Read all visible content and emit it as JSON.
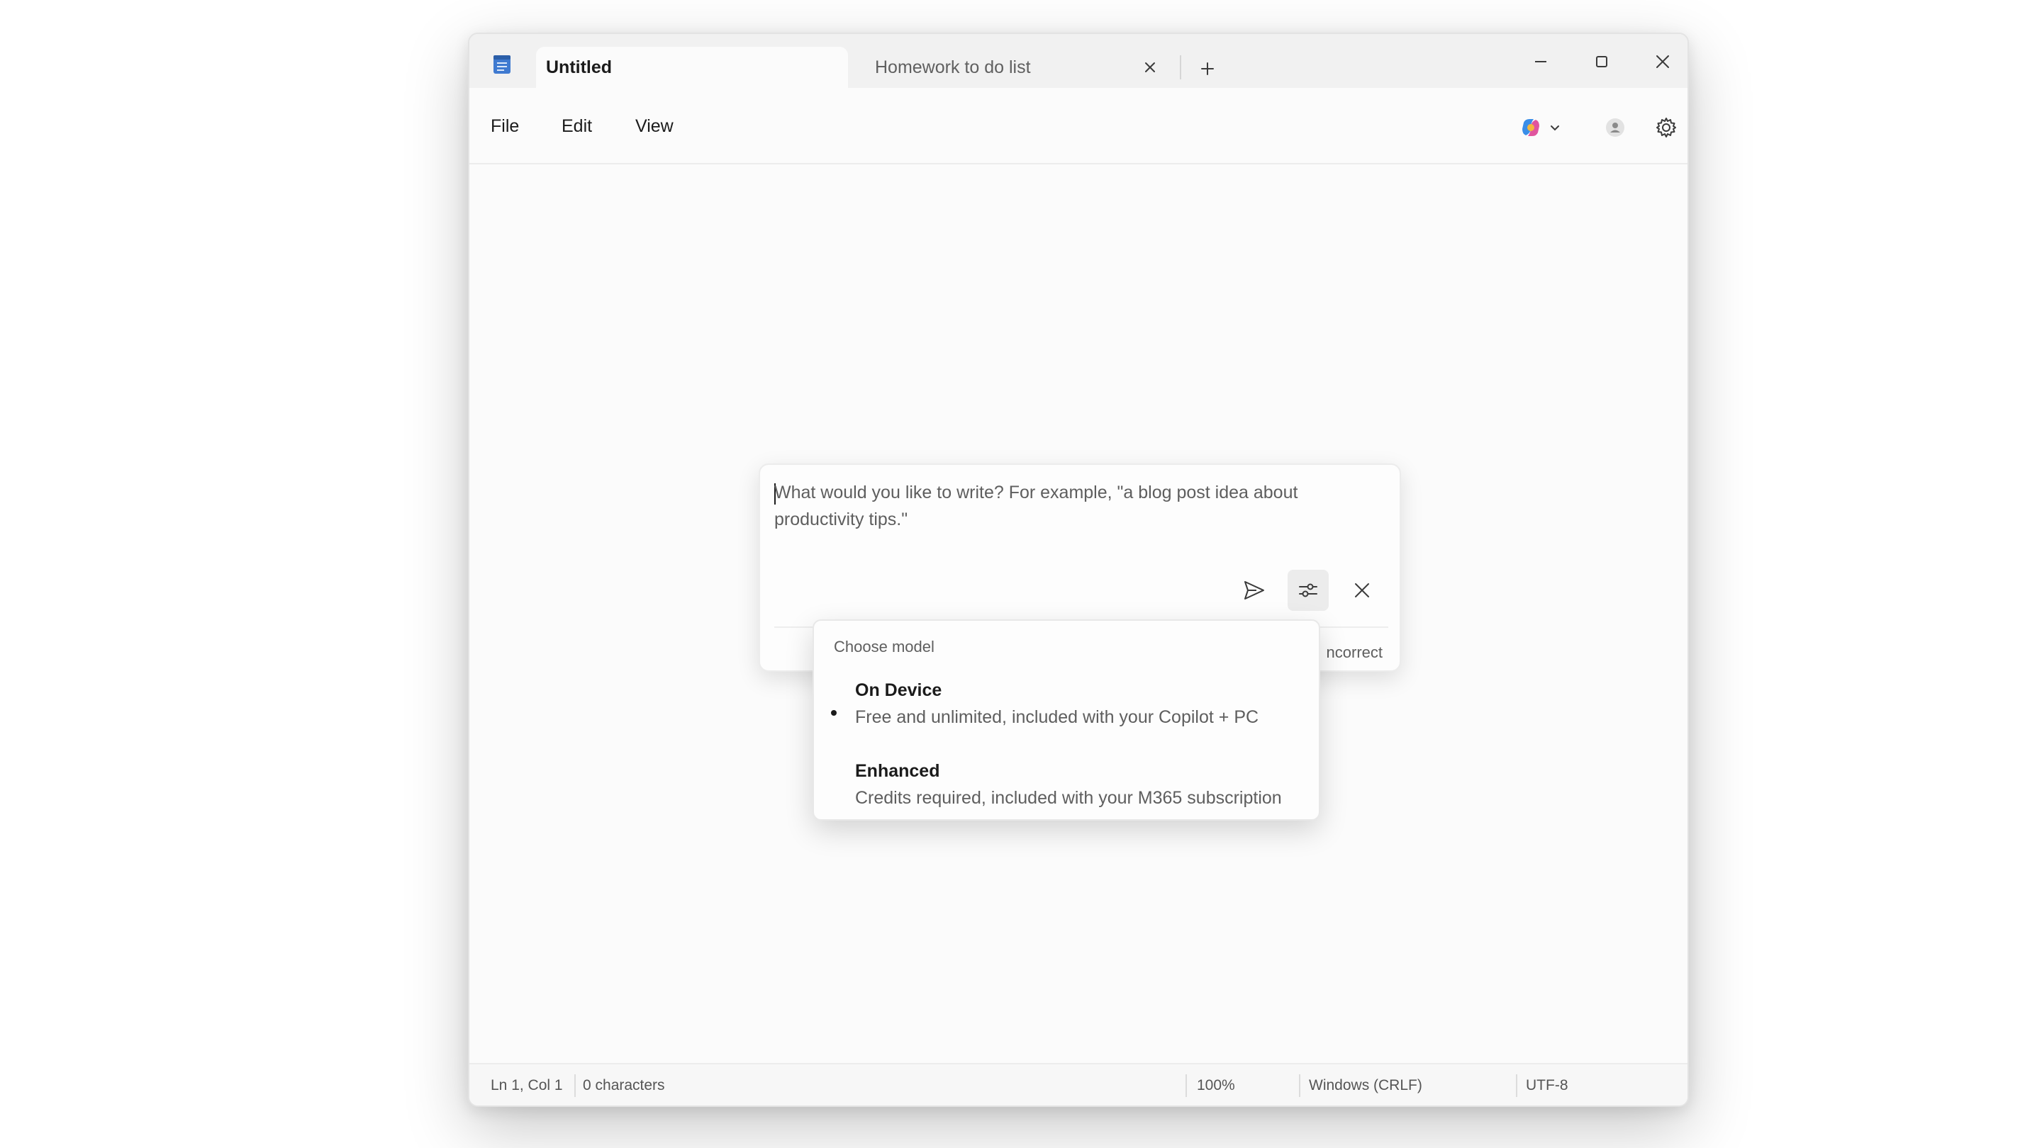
{
  "tabs": {
    "active": {
      "label": "Untitled"
    },
    "inactive": {
      "label": "Homework to do list"
    }
  },
  "menu": {
    "file": "File",
    "edit": "Edit",
    "view": "View"
  },
  "prompt": {
    "placeholder": "What would you like to write? For example, \"a blog post idea about productivity tips.\"",
    "footer_text": "ncorrect"
  },
  "model_menu": {
    "header": "Choose model",
    "options": [
      {
        "title": "On Device",
        "description": "Free and unlimited, included with your Copilot + PC",
        "selected": true
      },
      {
        "title": "Enhanced",
        "description": "Credits required, included with your M365 subscription",
        "selected": false
      }
    ]
  },
  "status": {
    "position": "Ln 1, Col 1",
    "characters": "0 characters",
    "zoom": "100%",
    "line_ending": "Windows (CRLF)",
    "encoding": "UTF-8"
  },
  "icons": {
    "app": "notepad-icon",
    "copilot": "copilot-icon",
    "account": "account-icon",
    "settings": "gear-icon",
    "send": "send-icon",
    "model_settings": "sliders-icon",
    "close": "close-icon"
  },
  "colors": {
    "window_bg": "#fbfbfb",
    "titlebar_bg": "#f1f1f1",
    "app_icon": "#3a73c2"
  }
}
